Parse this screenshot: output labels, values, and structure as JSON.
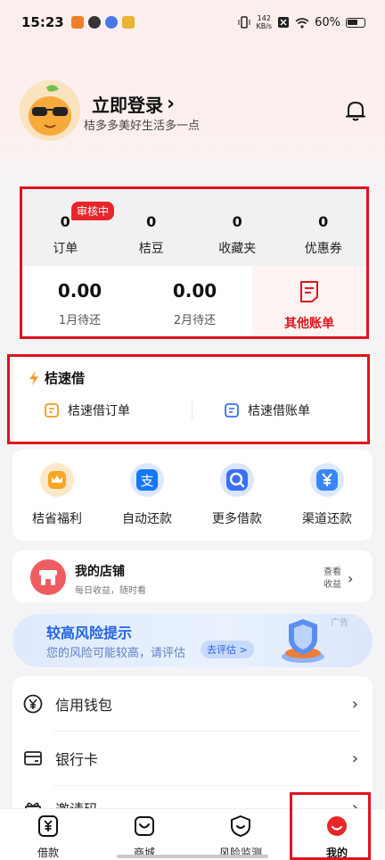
{
  "status_bar": {
    "time": "15:23",
    "net_speed_value": "142",
    "net_speed_unit": "KB/s",
    "battery": "60%"
  },
  "header": {
    "login_label": "立即登录",
    "login_arrow": "›",
    "slogan": "桔多多美好生活多一点"
  },
  "stats": {
    "items": [
      {
        "value": "0",
        "label": "订单"
      },
      {
        "value": "0",
        "label": "桔豆"
      },
      {
        "value": "0",
        "label": "收藏夹"
      },
      {
        "value": "0",
        "label": "优惠券"
      }
    ],
    "review_badge": "审核中"
  },
  "bills": {
    "items": [
      {
        "amount": "0.00",
        "label": "1月待还"
      },
      {
        "amount": "0.00",
        "label": "2月待还"
      }
    ],
    "other_label": "其他账单"
  },
  "speed_loan": {
    "title": "桔速借",
    "order_label": "桔速借订单",
    "bill_label": "桔速借账单"
  },
  "quick_actions": [
    {
      "label": "桔省福利",
      "icon": "crown-icon",
      "color": "#f5a623"
    },
    {
      "label": "自动还款",
      "icon": "alipay-icon",
      "color": "#1677ff"
    },
    {
      "label": "更多借款",
      "icon": "search-icon",
      "color": "#3a6ff7"
    },
    {
      "label": "渠道还款",
      "icon": "yuan-icon",
      "color": "#3a86f7"
    }
  ],
  "shop": {
    "title": "我的店铺",
    "subtitle": "每日收益，随时看",
    "link_line1": "查看",
    "link_line2": "收益"
  },
  "risk_banner": {
    "title": "较高风险提示",
    "subtitle": "您的风险可能较高，请评估",
    "button": "去评估 >",
    "ad": "广告"
  },
  "menu": [
    {
      "label": "信用钱包",
      "icon": "yuan-circle-icon"
    },
    {
      "label": "银行卡",
      "icon": "card-icon"
    },
    {
      "label": "邀请码",
      "icon": "gift-icon"
    }
  ],
  "tabs": [
    {
      "label": "借款",
      "icon": "loan-icon"
    },
    {
      "label": "商城",
      "icon": "mall-icon"
    },
    {
      "label": "风险监测",
      "icon": "shield-icon"
    },
    {
      "label": "我的",
      "icon": "mine-icon",
      "active": true
    }
  ],
  "colors": {
    "accent_red": "#e0141e",
    "blue": "#2364e6",
    "orange": "#f39a1b"
  }
}
